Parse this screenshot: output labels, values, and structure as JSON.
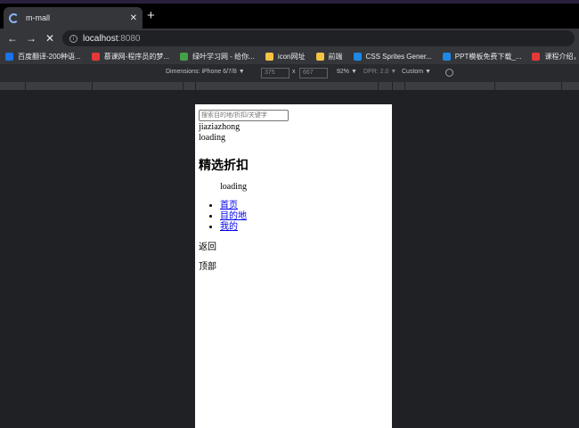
{
  "browser": {
    "tab": {
      "title": "m-mall",
      "close": "✕"
    },
    "new_tab": "+",
    "nav": {
      "back": "←",
      "forward": "→",
      "stop": "✕"
    },
    "url": {
      "host": "localhost",
      "port": ":8080"
    },
    "bookmarks": [
      {
        "label": "百度翻译-200种语...",
        "color": "#1a73e8"
      },
      {
        "label": "慕课网-程序员的梦...",
        "color": "#e53935"
      },
      {
        "label": "绿叶学习网 - 给你...",
        "color": "#43a047"
      },
      {
        "label": "icon网址",
        "color": "#f6c343"
      },
      {
        "label": "前端",
        "color": "#f6c343"
      },
      {
        "label": "CSS Sprites Gener...",
        "color": "#1e88e5"
      },
      {
        "label": "PPT模板免费下载_...",
        "color": "#1e88e5"
      },
      {
        "label": "课程介绍，No",
        "color": "#e53935"
      }
    ]
  },
  "devtools": {
    "dimensions": "Dimensions: iPhone 6/7/8 ▼",
    "width": "375",
    "x": "x",
    "height": "667",
    "zoom": "92% ▼",
    "dpr": "DPR: 2.0 ▼",
    "throttle": "Custom ▼"
  },
  "page": {
    "search_placeholder": "搜索目的地/折扣/关键字",
    "brand": "jiaziazhong",
    "loading1": "loading",
    "section_title": "精选折扣",
    "loading2": "loading",
    "nav_items": [
      "首页",
      "目的地",
      "我的"
    ],
    "back": "返回",
    "top": "顶部"
  }
}
